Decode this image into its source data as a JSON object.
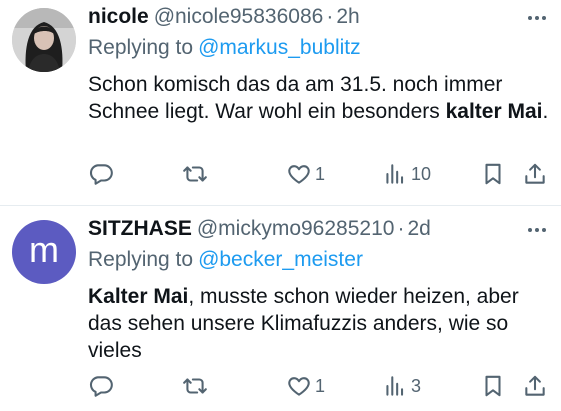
{
  "tweets": [
    {
      "name": "nicole",
      "handle": "@nicole95836086",
      "separator": "·",
      "time": "2h",
      "replying_label": "Replying to",
      "replying_to": "@markus_bublitz",
      "text_part1": "Schon komisch das da am 31.5. noch immer Schnee liegt. War wohl ein besonders ",
      "text_bold": "kalter Mai",
      "text_part2": ".",
      "likes": "1",
      "views": "10",
      "avatar_icon": "profile-photo"
    },
    {
      "name": "SITZHASE",
      "handle": "@mickymo96285210",
      "separator": "·",
      "time": "2d",
      "replying_label": "Replying to",
      "replying_to": "@becker_meister",
      "text_bold": "Kalter Mai",
      "text_part2": ", musste schon wieder heizen, aber das sehen unsere Klimafuzzis anders, wie so vieles",
      "likes": "1",
      "views": "3",
      "avatar_letter": "m",
      "avatar_color": "#5c5bc1"
    }
  ],
  "colors": {
    "accent": "#1d9bf0",
    "secondary_text": "#536471",
    "primary_text": "#0f1419",
    "divider": "#e6ecf0"
  }
}
